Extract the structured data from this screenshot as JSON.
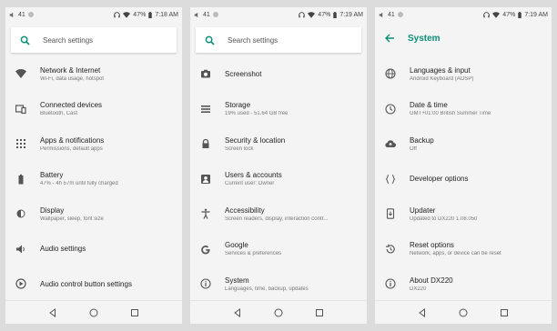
{
  "screens": [
    {
      "status": {
        "left": "41",
        "battery": "47%",
        "time": "7:18 AM"
      },
      "search_placeholder": "Search settings",
      "items": [
        {
          "icon": "wifi-icon",
          "title": "Network & Internet",
          "sub": "Wi-Fi, data usage, hotspot"
        },
        {
          "icon": "devices-icon",
          "title": "Connected devices",
          "sub": "Bluetooth, Cast"
        },
        {
          "icon": "apps-icon",
          "title": "Apps & notifications",
          "sub": "Permissions, default apps"
        },
        {
          "icon": "battery-icon",
          "title": "Battery",
          "sub": "47% - 4h 57m until fully charged"
        },
        {
          "icon": "display-icon",
          "title": "Display",
          "sub": "Wallpaper, sleep, font size"
        },
        {
          "icon": "audio-icon",
          "title": "Audio settings",
          "sub": ""
        },
        {
          "icon": "audio-control-icon",
          "title": "Audio control button settings",
          "sub": ""
        }
      ]
    },
    {
      "status": {
        "left": "41",
        "battery": "47%",
        "time": "7:19 AM"
      },
      "search_placeholder": "Search settings",
      "items": [
        {
          "icon": "screenshot-icon",
          "title": "Screenshot",
          "sub": ""
        },
        {
          "icon": "storage-icon",
          "title": "Storage",
          "sub": "19% used - 51.64 GB free"
        },
        {
          "icon": "lock-icon",
          "title": "Security & location",
          "sub": "Screen lock"
        },
        {
          "icon": "users-icon",
          "title": "Users & accounts",
          "sub": "Current user: Owner"
        },
        {
          "icon": "accessibility-icon",
          "title": "Accessibility",
          "sub": "Screen readers, display, interaction contr..."
        },
        {
          "icon": "google-icon",
          "title": "Google",
          "sub": "Services & preferences"
        },
        {
          "icon": "info-icon",
          "title": "System",
          "sub": "Languages, time, backup, updates"
        }
      ]
    },
    {
      "status": {
        "left": "41",
        "battery": "47%",
        "time": "7:19 AM"
      },
      "title": "System",
      "items": [
        {
          "icon": "globe-icon",
          "title": "Languages & input",
          "sub": "Android Keyboard (AOSP)"
        },
        {
          "icon": "clock-icon",
          "title": "Date & time",
          "sub": "GMT+01:00 British Summer Time"
        },
        {
          "icon": "cloud-upload-icon",
          "title": "Backup",
          "sub": "Off"
        },
        {
          "icon": "code-braces-icon",
          "title": "Developer options",
          "sub": ""
        },
        {
          "icon": "system-update-icon",
          "title": "Updater",
          "sub": "Updated to DX220 1.08.050"
        },
        {
          "icon": "restore-icon",
          "title": "Reset options",
          "sub": "Network, apps, or device can be reset"
        },
        {
          "icon": "info-icon",
          "title": "About DX220",
          "sub": "DX220"
        }
      ]
    }
  ],
  "colors": {
    "accent": "#0b8f78",
    "icon": "#555555",
    "background": "#f4f4f4"
  }
}
